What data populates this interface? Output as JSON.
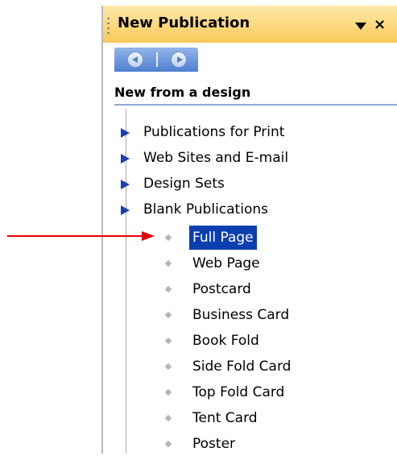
{
  "pane": {
    "title": "New Publication",
    "title_bar_color": "#f9c95a",
    "nav_bar_color": "#4e7fd0"
  },
  "section": {
    "heading": "New from a design"
  },
  "categories": [
    {
      "label": "Publications for Print"
    },
    {
      "label": "Web Sites and E-mail"
    },
    {
      "label": "Design Sets"
    },
    {
      "label": "Blank Publications"
    }
  ],
  "blank_items": [
    {
      "label": "Full Page",
      "selected": true
    },
    {
      "label": "Web Page",
      "selected": false
    },
    {
      "label": "Postcard",
      "selected": false
    },
    {
      "label": "Business Card",
      "selected": false
    },
    {
      "label": "Book Fold",
      "selected": false
    },
    {
      "label": "Side Fold Card",
      "selected": false
    },
    {
      "label": "Top Fold Card",
      "selected": false
    },
    {
      "label": "Tent Card",
      "selected": false
    },
    {
      "label": "Poster",
      "selected": false
    }
  ],
  "colors": {
    "selection": "#0b3faf",
    "category_triangle": "#1b3fb5",
    "annotation_arrow": "#e10000"
  }
}
